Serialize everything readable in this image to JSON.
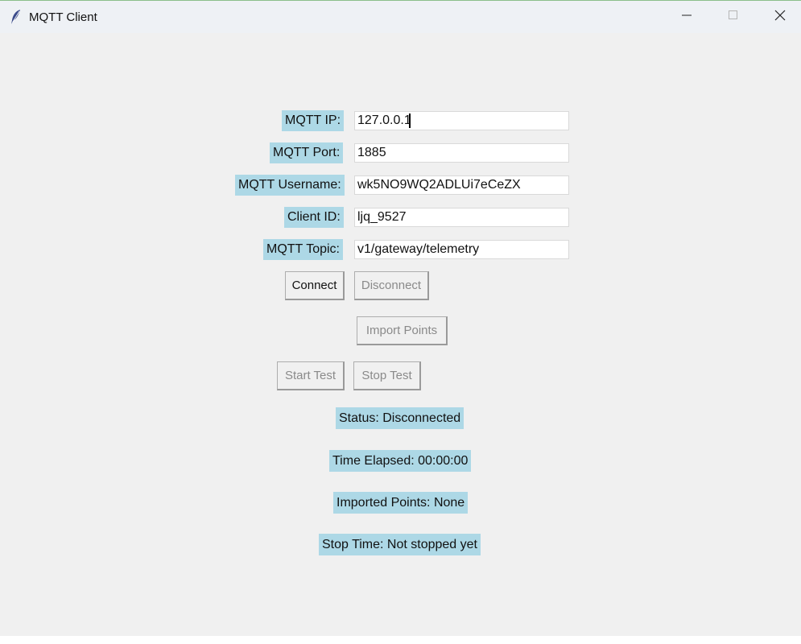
{
  "window": {
    "title": "MQTT Client",
    "icons": {
      "app": "feather-icon",
      "minimize": "minimize-icon",
      "maximize": "maximize-icon",
      "close": "close-icon"
    }
  },
  "form": {
    "ip_label": "MQTT IP:",
    "ip_value": "127.0.0.1",
    "port_label": "MQTT Port:",
    "port_value": "1885",
    "username_label": "MQTT Username:",
    "username_value": "wk5NO9WQ2ADLUi7eCeZX",
    "client_id_label": "Client ID:",
    "client_id_value": "ljq_9527",
    "topic_label": "MQTT Topic:",
    "topic_value": "v1/gateway/telemetry"
  },
  "buttons": {
    "connect": "Connect",
    "disconnect": "Disconnect",
    "import_points": "Import Points",
    "start_test": "Start Test",
    "stop_test": "Stop Test"
  },
  "status": {
    "connection": "Status: Disconnected",
    "time_elapsed": "Time Elapsed: 00:00:00",
    "imported_points": "Imported Points: None",
    "stop_time": "Stop Time: Not stopped yet"
  },
  "colors": {
    "label_bg": "#add8e6",
    "window_bg": "#f0f0f0"
  }
}
